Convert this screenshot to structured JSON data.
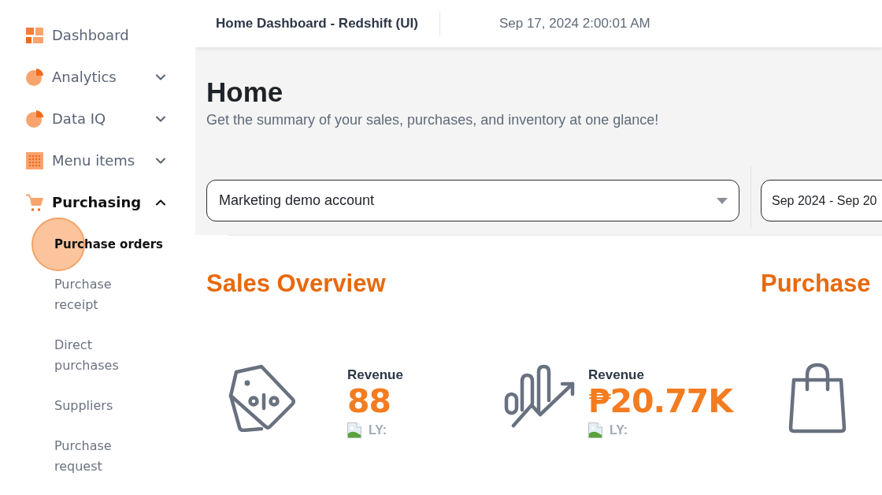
{
  "sidebar": {
    "items": [
      {
        "label": "Dashboard",
        "kind": "link"
      },
      {
        "label": "Analytics",
        "kind": "group",
        "expanded": false
      },
      {
        "label": "Data IQ",
        "kind": "group",
        "expanded": false
      },
      {
        "label": "Menu items",
        "kind": "group",
        "expanded": false
      },
      {
        "label": "Purchasing",
        "kind": "group",
        "expanded": true,
        "children": [
          {
            "label": "Purchase orders",
            "selected": true
          },
          {
            "label": "Purchase receipt",
            "selected": false
          },
          {
            "label": "Direct purchases",
            "selected": false
          },
          {
            "label": "Suppliers",
            "selected": false
          },
          {
            "label": "Purchase request",
            "selected": false
          }
        ]
      }
    ]
  },
  "header": {
    "title": "Home Dashboard - Redshift (UI)",
    "timestamp": "Sep 17, 2024 2:00:01 AM"
  },
  "page": {
    "title": "Home",
    "subtitle": "Get the summary of your sales, purchases, and inventory at one glance!"
  },
  "filters": {
    "account": {
      "value": "Marketing demo account"
    },
    "date_range": {
      "value": "Sep 2024 - Sep 20"
    }
  },
  "sections": [
    {
      "title": "Sales Overview",
      "metrics": [
        {
          "label": "Revenue",
          "value": "88",
          "comparison": "LY:"
        },
        {
          "label": "Revenue",
          "value": "₱20.77K",
          "comparison": "LY:"
        }
      ]
    },
    {
      "title": "Purchase"
    }
  ]
}
